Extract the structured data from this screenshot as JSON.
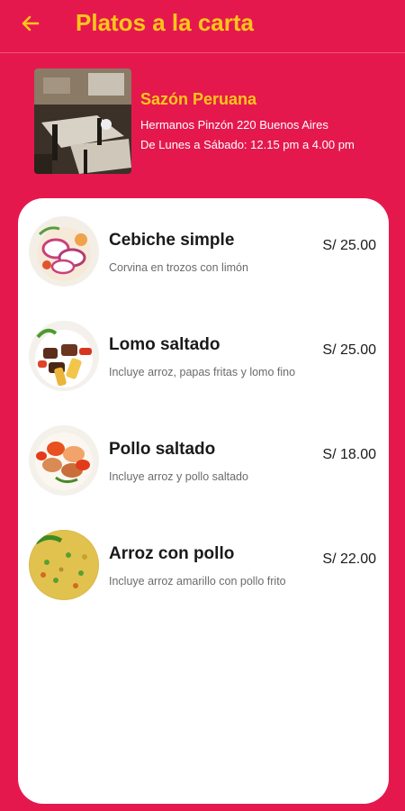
{
  "header": {
    "title": "Platos a la carta",
    "back_icon": "arrow-left-icon",
    "accent_color": "#ffc61a",
    "background_color": "#e5184e"
  },
  "restaurant": {
    "name": "Sazón Peruana",
    "address": "Hermanos Pinzón 220 Buenos Aires",
    "hours": "De Lunes a Sábado: 12.15 pm a 4.00 pm"
  },
  "dishes": [
    {
      "name": "Cebiche simple",
      "description": "Corvina en trozos con limón",
      "price": "S/ 25.00"
    },
    {
      "name": "Lomo saltado",
      "description": "Incluye arroz, papas fritas y lomo fino",
      "price": "S/ 25.00"
    },
    {
      "name": "Pollo saltado",
      "description": "Incluye arroz y pollo saltado",
      "price": "S/ 18.00"
    },
    {
      "name": "Arroz con pollo",
      "description": "Incluye arroz amarillo con pollo frito",
      "price": "S/ 22.00"
    }
  ]
}
